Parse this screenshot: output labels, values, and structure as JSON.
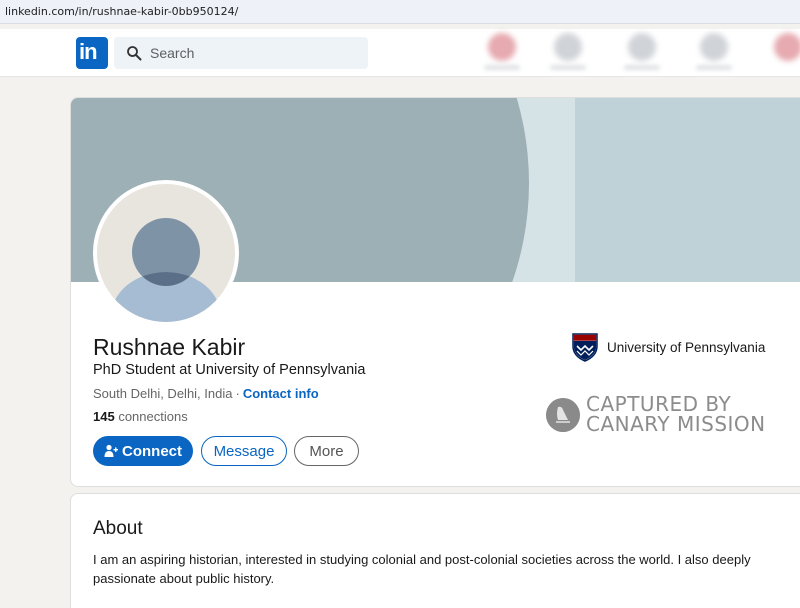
{
  "browser": {
    "url": "linkedin.com/in/rushnae-kabir-0bb950124/"
  },
  "header": {
    "logo_text": "in",
    "search_placeholder": "Search",
    "brand_color": "#0a66c2"
  },
  "profile": {
    "name": "Rushnae Kabir",
    "headline": "PhD Student at University of Pennsylvania",
    "location": "South Delhi, Delhi, India",
    "separator": "·",
    "contact_info_label": "Contact info",
    "connections_count": "145",
    "connections_label": "connections",
    "education": "University of Pennsylvania",
    "buttons": {
      "connect": "Connect",
      "message": "Message",
      "more": "More"
    },
    "watermark_line1": "CAPTURED BY",
    "watermark_line2": "CANARY MISSION"
  },
  "about": {
    "title": "About",
    "text": "I am an aspiring historian, interested in studying colonial and post-colonial societies across the world. I also deeply passionate about public history."
  },
  "icons": [
    "search-icon",
    "add-person-icon",
    "university-shield-icon",
    "canary-bird-icon",
    "default-avatar-icon"
  ]
}
